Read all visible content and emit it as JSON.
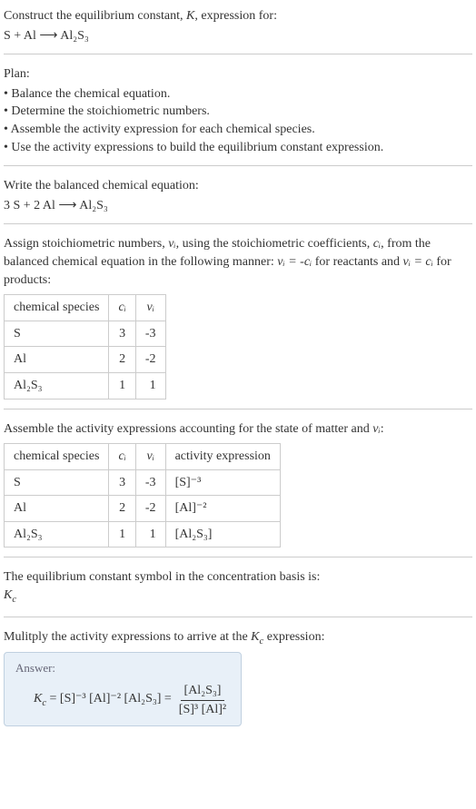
{
  "prompt": {
    "line1": "Construct the equilibrium constant, ",
    "K": "K",
    "line1_end": ", expression for:",
    "equation": "S + Al ⟶ Al₂S₃"
  },
  "plan": {
    "title": "Plan:",
    "items": [
      "• Balance the chemical equation.",
      "• Determine the stoichiometric numbers.",
      "• Assemble the activity expression for each chemical species.",
      "• Use the activity expressions to build the equilibrium constant expression."
    ]
  },
  "balanced": {
    "intro": "Write the balanced chemical equation:",
    "equation": "3 S + 2 Al ⟶ Al₂S₃"
  },
  "stoich": {
    "intro_part1": "Assign stoichiometric numbers, ",
    "nu_i": "νᵢ",
    "intro_part2": ", using the stoichiometric coefficients, ",
    "c_i": "cᵢ",
    "intro_part3": ", from the balanced chemical equation in the following manner: ",
    "rel1": "νᵢ = -cᵢ",
    "intro_part4": " for reactants and ",
    "rel2": "νᵢ = cᵢ",
    "intro_part5": " for products:",
    "headers": {
      "species": "chemical species",
      "ci": "cᵢ",
      "vi": "νᵢ"
    },
    "rows": [
      {
        "species": "S",
        "ci": "3",
        "vi": "-3"
      },
      {
        "species": "Al",
        "ci": "2",
        "vi": "-2"
      },
      {
        "species": "Al₂S₃",
        "ci": "1",
        "vi": "1"
      }
    ]
  },
  "activity": {
    "intro_part1": "Assemble the activity expressions accounting for the state of matter and ",
    "nu_i": "νᵢ",
    "intro_part2": ":",
    "headers": {
      "species": "chemical species",
      "ci": "cᵢ",
      "vi": "νᵢ",
      "ae": "activity expression"
    },
    "rows": [
      {
        "species": "S",
        "ci": "3",
        "vi": "-3",
        "ae": "[S]⁻³"
      },
      {
        "species": "Al",
        "ci": "2",
        "vi": "-2",
        "ae": "[Al]⁻²"
      },
      {
        "species": "Al₂S₃",
        "ci": "1",
        "vi": "1",
        "ae": "[Al₂S₃]"
      }
    ]
  },
  "symbol": {
    "intro": "The equilibrium constant symbol in the concentration basis is:",
    "kc": "K",
    "kc_sub": "c"
  },
  "multiply": {
    "intro_part1": "Mulitply the activity expressions to arrive at the ",
    "kc": "K",
    "kc_sub": "c",
    "intro_part2": " expression:"
  },
  "answer": {
    "title": "Answer:",
    "kc": "K",
    "kc_sub": "c",
    "eq": " = [S]⁻³ [Al]⁻² [Al₂S₃] = ",
    "frac_num": "[Al₂S₃]",
    "frac_den": "[S]³ [Al]²"
  }
}
